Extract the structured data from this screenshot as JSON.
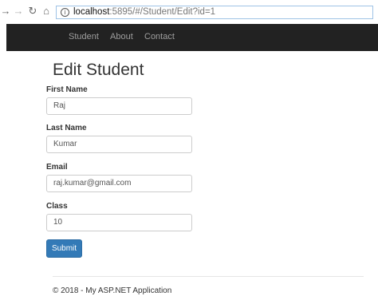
{
  "browser": {
    "back_icon": "back-arrow-icon",
    "forward_icon": "forward-arrow-icon",
    "reload_icon": "reload-icon",
    "home_icon": "home-icon",
    "url_host": "localhost",
    "url_path": ":5895/#/Student/Edit?id=1"
  },
  "navbar": {
    "links": [
      "Student",
      "About",
      "Contact"
    ]
  },
  "page": {
    "title": "Edit Student"
  },
  "form": {
    "first_name_label": "First Name",
    "first_name_value": "Raj",
    "last_name_label": "Last Name",
    "last_name_value": "Kumar",
    "email_label": "Email",
    "email_value": "raj.kumar@gmail.com",
    "class_label": "Class",
    "class_value": "10",
    "submit_label": "Submit"
  },
  "footer": {
    "text": "© 2018 - My ASP.NET Application"
  },
  "colors": {
    "navbar_bg": "#222222",
    "primary_button": "#337ab7"
  }
}
